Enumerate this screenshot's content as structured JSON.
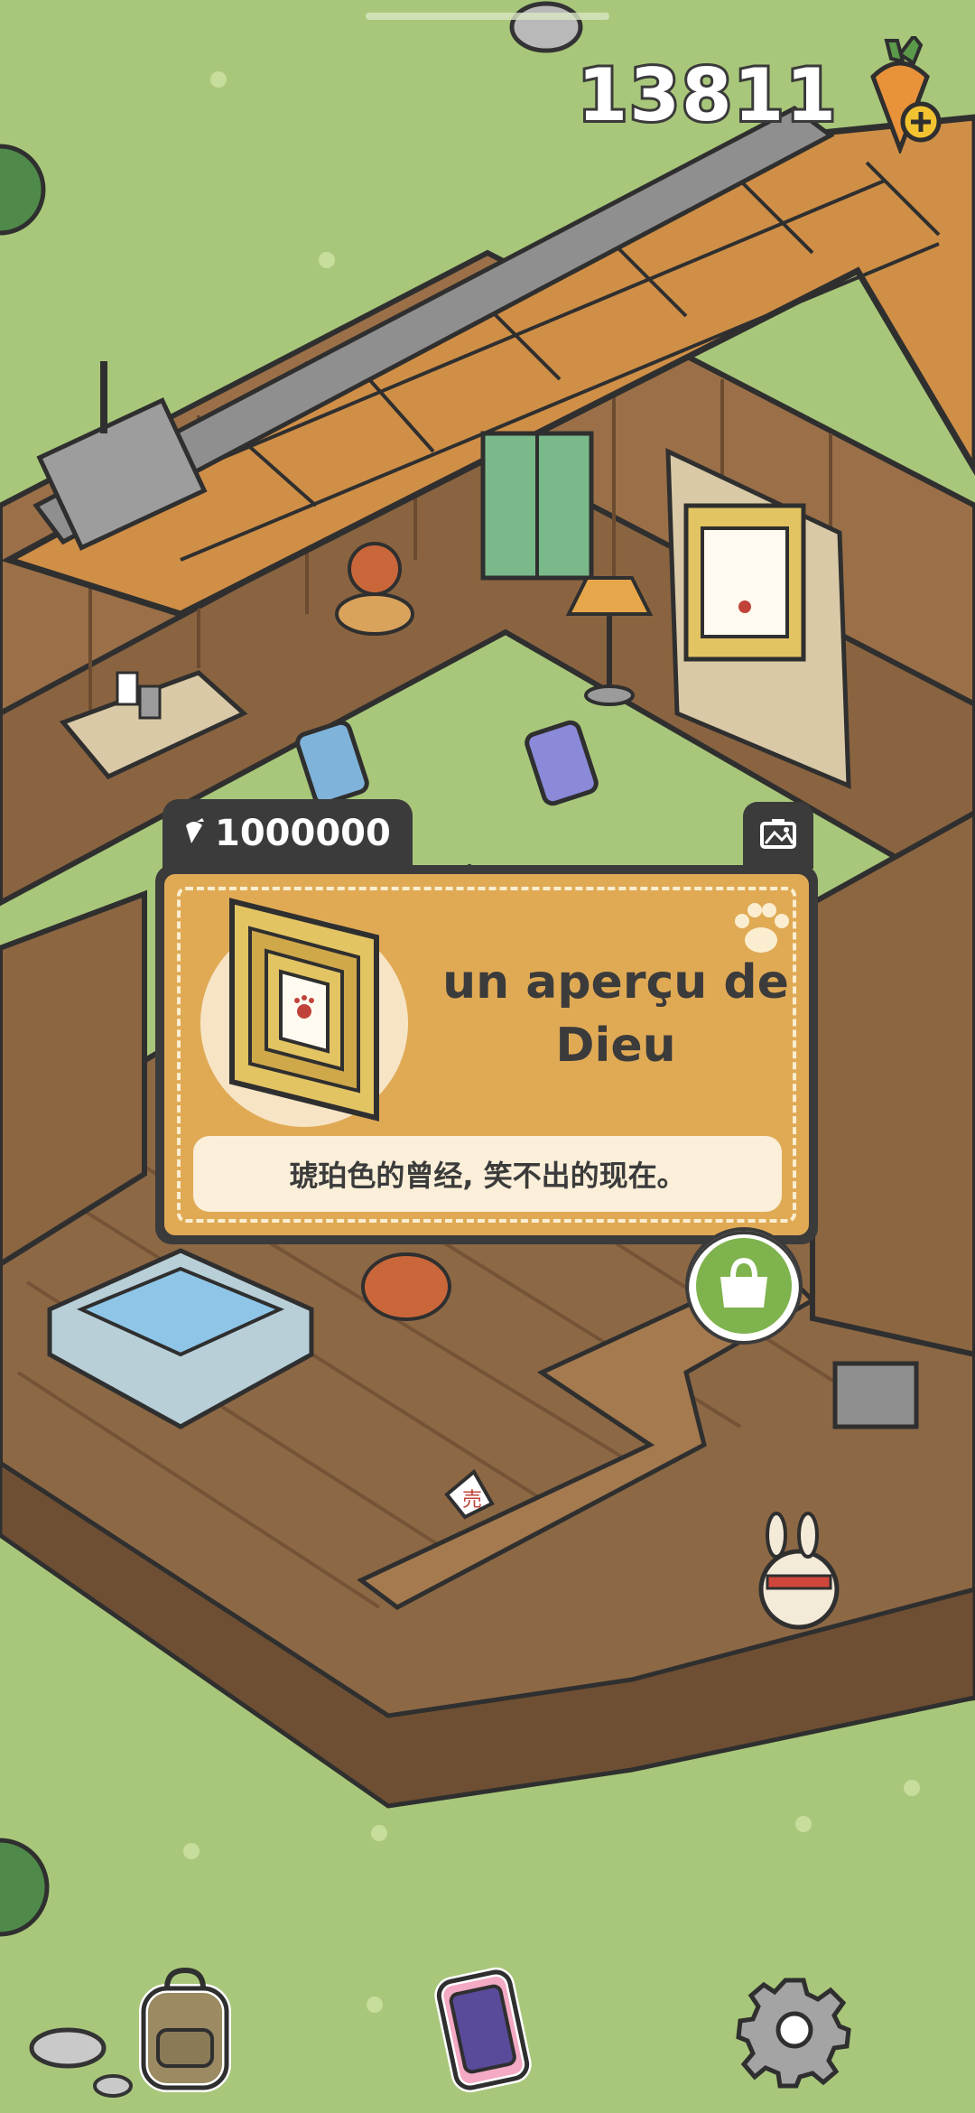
{
  "currency": {
    "value": "13811",
    "icon": "carrot-plus-icon"
  },
  "popup": {
    "price": "1000000",
    "price_icon": "carrot-icon",
    "item_name_line1": "un aperçu de",
    "item_name_line2": "Dieu",
    "description": "琥珀色的曾经, 笑不出的现在。",
    "item_icon": "framed-painting-icon",
    "photo_icon": "photo-icon",
    "buy_icon": "shopping-bag-icon"
  },
  "scene": {
    "sign_text": "売"
  },
  "bottom_bar": [
    {
      "icon": "backpack-icon"
    },
    {
      "icon": "phone-icon"
    },
    {
      "icon": "gear-icon"
    }
  ],
  "colors": {
    "grass": "#a9c77a",
    "popup_gold": "#e0aa55",
    "dark": "#3b3b3b",
    "buy_green": "#7fb34d"
  }
}
